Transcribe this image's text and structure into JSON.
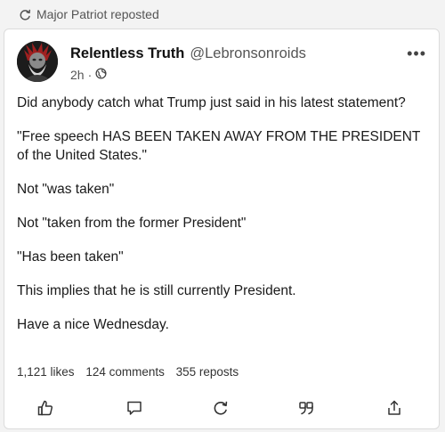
{
  "repost_bar": {
    "icon": "repost-icon",
    "text": "Major Patriot reposted"
  },
  "post": {
    "author": {
      "display_name": "Relentless Truth",
      "handle": "@Lebronsonroids",
      "avatar_icon": "avatar-image"
    },
    "time": "2h",
    "separator": "·",
    "visibility_icon": "globe-icon",
    "more_label": "•••",
    "paragraphs": [
      "Did anybody catch what Trump just said in his latest statement?",
      "\"Free speech HAS BEEN TAKEN AWAY FROM THE PRESIDENT of the United States.\"",
      "Not \"was taken\"",
      "Not \"taken from the former President\"",
      "\"Has been taken\"",
      "This implies that he is still currently President.",
      "Have a nice Wednesday."
    ],
    "stats": {
      "likes": "1,121 likes",
      "comments": "124 comments",
      "reposts": "355 reposts"
    },
    "actions": [
      {
        "name": "like-icon"
      },
      {
        "name": "comment-icon"
      },
      {
        "name": "repost-icon"
      },
      {
        "name": "quote-icon"
      },
      {
        "name": "share-icon"
      }
    ]
  }
}
